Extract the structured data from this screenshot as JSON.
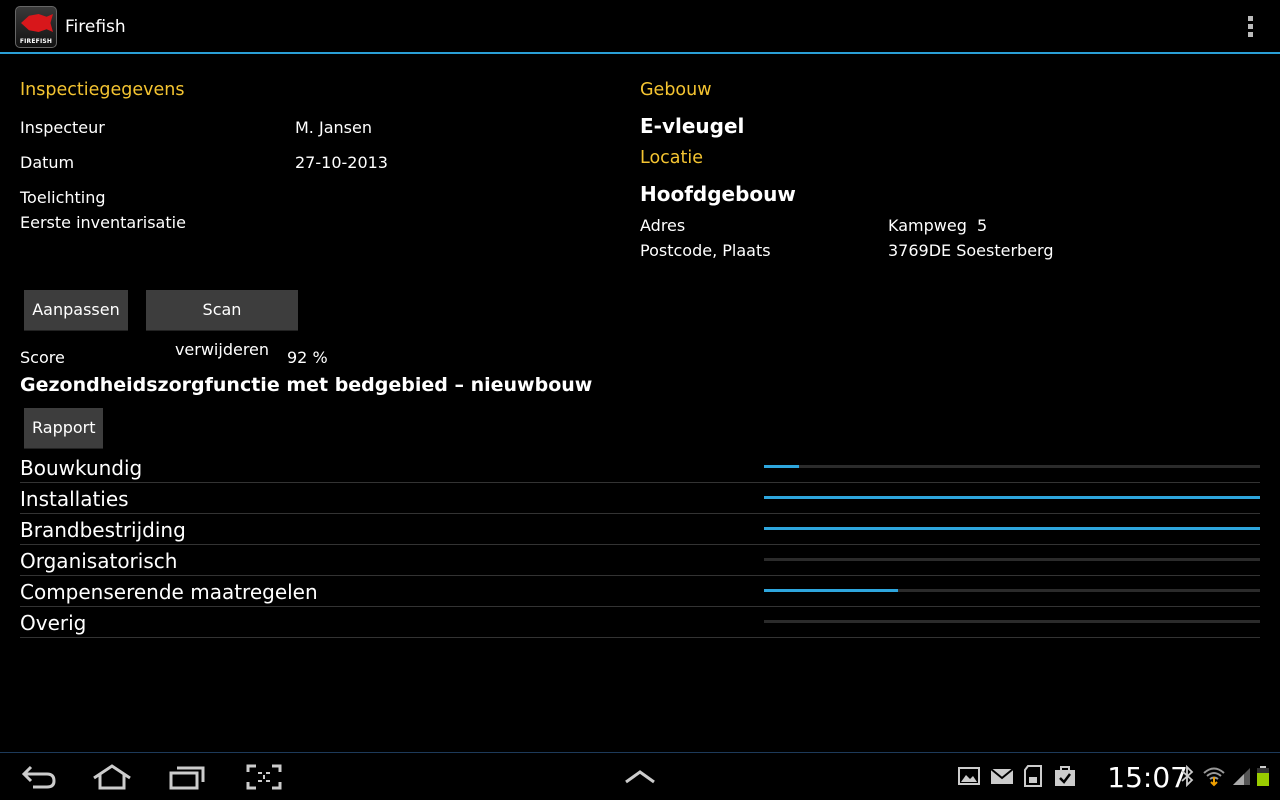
{
  "app": {
    "title": "Firefish",
    "icon_text": "FIREFISH"
  },
  "inspection": {
    "section_title": "Inspectiegegevens",
    "inspector_label": "Inspecteur",
    "inspector_value": "M. Jansen",
    "date_label": "Datum",
    "date_value": "27-10-2013",
    "note_label": "Toelichting",
    "note_value": "Eerste inventarisatie"
  },
  "building": {
    "section_title": "Gebouw",
    "name": "E-vleugel",
    "location_title": "Locatie",
    "location_name": "Hoofdgebouw",
    "address_label": "Adres",
    "address_value": "Kampweg  5",
    "postcode_label": "Postcode, Plaats",
    "postcode_value": "3769DE Soesterberg"
  },
  "actions": {
    "edit": "Aanpassen",
    "delete_scan": "Scan verwijderen",
    "report": "Rapport"
  },
  "score": {
    "label": "Score",
    "value": "92 %",
    "function": "Gezondheidszorgfunctie met bedgebied – nieuwbouw"
  },
  "categories": [
    {
      "name": "Bouwkundig",
      "progress": 0.07
    },
    {
      "name": "Installaties",
      "progress": 1.0
    },
    {
      "name": "Brandbestrijding",
      "progress": 1.0
    },
    {
      "name": "Organisatorisch",
      "progress": 0.0
    },
    {
      "name": "Compenserende maatregelen",
      "progress": 0.27
    },
    {
      "name": "Overig",
      "progress": 0.0
    }
  ],
  "statusbar": {
    "time": "15:07"
  },
  "colors": {
    "accent": "#2ea6dd",
    "section": "#f4c431",
    "background": "#000000"
  }
}
